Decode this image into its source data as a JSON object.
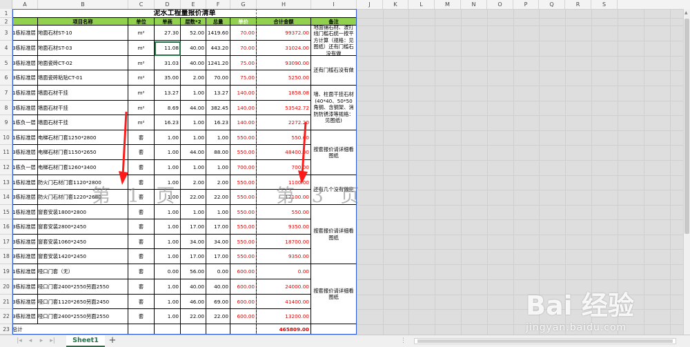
{
  "columns": [
    "A",
    "B",
    "C",
    "D",
    "E",
    "F",
    "G",
    "H",
    "I",
    "J",
    "K",
    "L",
    "M",
    "N",
    "O",
    "P",
    "Q",
    "R",
    "S"
  ],
  "title": "泥水工程量报价清单",
  "headers": {
    "name": "项目名称",
    "unit": "单位",
    "price": "单画",
    "floors": "层数*2",
    "total": "总量",
    "unitprice": "单价",
    "amount": "合计金额",
    "remark": "备注"
  },
  "rows": [
    {
      "n": "3",
      "a": "1栋标准层",
      "b": "地面石材ST-10",
      "c": "m²",
      "d": "27.30",
      "e": "52.00",
      "f": "1419.60",
      "g": "70.00",
      "h": "99372.00"
    },
    {
      "n": "4",
      "a": "3栋标准层",
      "b": "地面石材ST-03",
      "c": "m²",
      "d": "11.08",
      "e": "40.00",
      "f": "443.20",
      "g": "70.00",
      "h": "31024.00"
    },
    {
      "n": "5",
      "a": "3栋标准层",
      "b": "地面瓷砖CT-02",
      "c": "m²",
      "d": "31.03",
      "e": "40.00",
      "f": "1241.20",
      "g": "75.00",
      "h": "93090.00"
    },
    {
      "n": "6",
      "a": "3栋标准层",
      "b": "墙面瓷砖粘贴CT-01",
      "c": "m²",
      "d": "35.00",
      "e": "2.00",
      "f": "70.00",
      "g": "75.00",
      "h": "5250.00"
    },
    {
      "n": "7",
      "a": "1栋标准层",
      "b": "墙面石材干挂",
      "c": "m²",
      "d": "13.27",
      "e": "1.00",
      "f": "13.27",
      "g": "140.00",
      "h": "1858.08"
    },
    {
      "n": "8",
      "a": "3栋标准层",
      "b": "墙面石材干挂",
      "c": "m²",
      "d": "8.69",
      "e": "44.00",
      "f": "382.45",
      "g": "140.00",
      "h": "53542.72"
    },
    {
      "n": "9",
      "a": "1栋负一层",
      "b": "墙面石材干挂",
      "c": "m²",
      "d": "16.23",
      "e": "1.00",
      "f": "16.23",
      "g": "140.00",
      "h": "2272.20"
    },
    {
      "n": "10",
      "a": "1栋标准层",
      "b": "电梯石材门套1250*2800",
      "c": "套",
      "d": "1.00",
      "e": "1.00",
      "f": "1.00",
      "g": "550.00",
      "h": "550.00"
    },
    {
      "n": "11",
      "a": "3栋标准层",
      "b": "电梯石材门套1150*2650",
      "c": "套",
      "d": "1.00",
      "e": "44.00",
      "f": "88.00",
      "g": "550.00",
      "h": "48400.00"
    },
    {
      "n": "12",
      "a": "1栋负一层",
      "b": "电梯石材门套1260*3400",
      "c": "套",
      "d": "1.00",
      "e": "1.00",
      "f": "1.00",
      "g": "700.00",
      "h": "700.00"
    },
    {
      "n": "13",
      "a": "1栋标准层",
      "b": "防火门石材门套1120*2800",
      "c": "套",
      "d": "1.00",
      "e": "2.00",
      "f": "2.00",
      "g": "550.00",
      "h": "1100.00"
    },
    {
      "n": "14",
      "a": "3栋标准层",
      "b": "防火门石材门套1220*2680",
      "c": "套",
      "d": "1.00",
      "e": "22.00",
      "f": "22.00",
      "g": "550.00",
      "h": "12100.00"
    },
    {
      "n": "15",
      "a": "1栋标准层",
      "b": "窗套安装1800*2800",
      "c": "套",
      "d": "1.00",
      "e": "1.00",
      "f": "1.00",
      "g": "550.00",
      "h": "550.00"
    },
    {
      "n": "16",
      "a": "3栋标准层",
      "b": "窗套安装2800*2450",
      "c": "套",
      "d": "1.00",
      "e": "17.00",
      "f": "17.00",
      "g": "550.00",
      "h": "9350.00"
    },
    {
      "n": "17",
      "a": "3栋标准层",
      "b": "窗套安装1060*2450",
      "c": "套",
      "d": "1.00",
      "e": "34.00",
      "f": "34.00",
      "g": "550.00",
      "h": "18700.00"
    },
    {
      "n": "18",
      "a": "3栋标准层",
      "b": "窗套安装1420*2450",
      "c": "套",
      "d": "1.00",
      "e": "17.00",
      "f": "17.00",
      "g": "550.00",
      "h": "9350.00"
    },
    {
      "n": "19",
      "a": "1栋标准层",
      "b": "哑口门套（无）",
      "c": "套",
      "d": "0.00",
      "e": "56.00",
      "f": "0.00",
      "g": "600.00",
      "h": "0.00"
    },
    {
      "n": "20",
      "a": "3栋标准层",
      "b": "哑口门套2400*2550另面2550",
      "c": "套",
      "d": "1.00",
      "e": "40.00",
      "f": "40.00",
      "g": "600.00",
      "h": "24000.00"
    },
    {
      "n": "21",
      "a": "3栋标准层",
      "b": "哑口门套1120*2650另面2450",
      "c": "套",
      "d": "1.00",
      "e": "46.00",
      "f": "69.00",
      "g": "600.00",
      "h": "41400.00"
    },
    {
      "n": "22",
      "a": "3栋标准层",
      "b": "哑口门套2400*2550另面2550",
      "c": "套",
      "d": "1.00",
      "e": "22.00",
      "f": "22.00",
      "g": "600.00",
      "h": "13200.00"
    }
  ],
  "total_row": {
    "n": "23",
    "label": "总计",
    "amount": "465809.00"
  },
  "notes": [
    "地面铺石材、波打线门槛石统一按平方计算（规格：见图纸）还有门槛石没有做",
    "还有门槛石没有做",
    "墙、柱面干挂石材(40*40、50*50角钢、含钢架、消防防锈漆等规格：见图纸)",
    "按套报价请详细看图纸",
    "还有几个没有做完",
    "按套报价请详细看图纸",
    "按套报价请详细看图纸"
  ],
  "watermark_left": "第 1 页",
  "watermark_right": "第 3 页",
  "sheet_tab": "Sheet1",
  "add_sheet": "+",
  "baidu_logo": "Bai 经验",
  "baidu_url": "jingyan.baidu.com",
  "colors": {
    "header_green": "#92d050",
    "red_values": "#e00000",
    "page_break": "#2b5bd6",
    "sheet_accent": "#217346"
  }
}
